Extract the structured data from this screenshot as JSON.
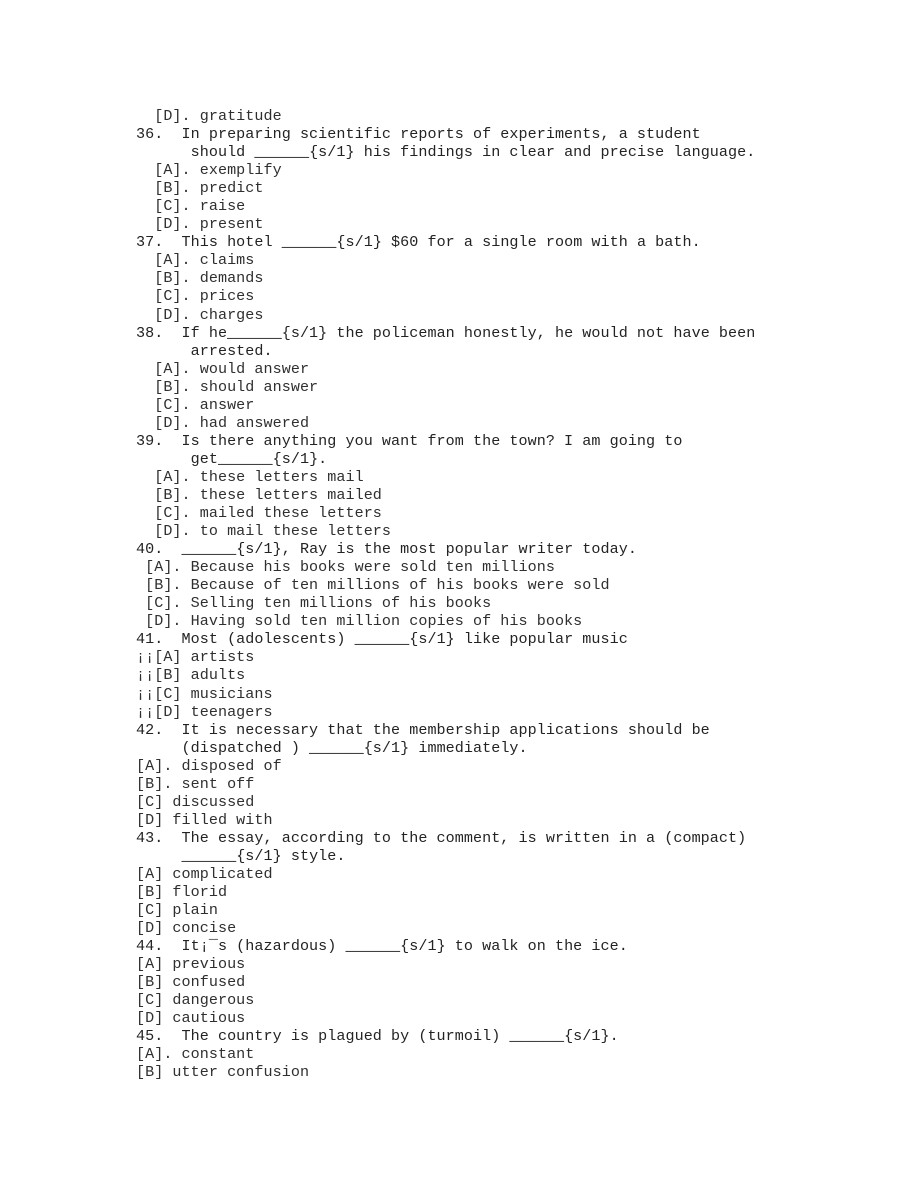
{
  "document": {
    "kind": "scanned-exam-page",
    "subject": "English grammar and vocabulary multiple choice",
    "question_range": "36-45",
    "text_color": "#2b2b2b",
    "page_background": "#ffffff",
    "blank_marker": "______",
    "gap_tag": "{s/1}",
    "mojibake_space": "¡¡",
    "mojibake_apostrophe": "¡‾"
  },
  "lines": [
    {
      "id": "l01",
      "indent": 2,
      "kind": "option",
      "text": "[D]. gratitude"
    },
    {
      "id": "l02",
      "indent": 0,
      "kind": "question",
      "text": "36.  In preparing scientific reports of experiments, a student"
    },
    {
      "id": "l03",
      "indent": 6,
      "kind": "continuation",
      "text": "should ______{s/1} his findings in clear and precise language."
    },
    {
      "id": "l04",
      "indent": 2,
      "kind": "option",
      "text": "[A]. exemplify"
    },
    {
      "id": "l05",
      "indent": 2,
      "kind": "option",
      "text": "[B]. predict"
    },
    {
      "id": "l06",
      "indent": 2,
      "kind": "option",
      "text": "[C]. raise"
    },
    {
      "id": "l07",
      "indent": 2,
      "kind": "option",
      "text": "[D]. present"
    },
    {
      "id": "l08",
      "indent": 0,
      "kind": "question",
      "text": "37.  This hotel ______{s/1} $60 for a single room with a bath."
    },
    {
      "id": "l09",
      "indent": 2,
      "kind": "option",
      "text": "[A]. claims"
    },
    {
      "id": "l10",
      "indent": 2,
      "kind": "option",
      "text": "[B]. demands"
    },
    {
      "id": "l11",
      "indent": 2,
      "kind": "option",
      "text": "[C]. prices"
    },
    {
      "id": "l12",
      "indent": 2,
      "kind": "option",
      "text": "[D]. charges"
    },
    {
      "id": "l13",
      "indent": 0,
      "kind": "question",
      "text": "38.  If he______{s/1} the policeman honestly, he would not have been"
    },
    {
      "id": "l14",
      "indent": 6,
      "kind": "continuation",
      "text": "arrested."
    },
    {
      "id": "l15",
      "indent": 2,
      "kind": "option",
      "text": "[A]. would answer"
    },
    {
      "id": "l16",
      "indent": 2,
      "kind": "option",
      "text": "[B]. should answer"
    },
    {
      "id": "l17",
      "indent": 2,
      "kind": "option",
      "text": "[C]. answer"
    },
    {
      "id": "l18",
      "indent": 2,
      "kind": "option",
      "text": "[D]. had answered"
    },
    {
      "id": "l19",
      "indent": 0,
      "kind": "question",
      "text": "39.  Is there anything you want from the town? I am going to"
    },
    {
      "id": "l20",
      "indent": 6,
      "kind": "continuation",
      "text": "get______{s/1}."
    },
    {
      "id": "l21",
      "indent": 2,
      "kind": "option",
      "text": "[A]. these letters mail"
    },
    {
      "id": "l22",
      "indent": 2,
      "kind": "option",
      "text": "[B]. these letters mailed"
    },
    {
      "id": "l23",
      "indent": 2,
      "kind": "option",
      "text": "[C]. mailed these letters"
    },
    {
      "id": "l24",
      "indent": 2,
      "kind": "option",
      "text": "[D]. to mail these letters"
    },
    {
      "id": "l25",
      "indent": 0,
      "kind": "question",
      "text": "40.  ______{s/1}, Ray is the most popular writer today."
    },
    {
      "id": "l26",
      "indent": 1,
      "kind": "option",
      "text": "[A]. Because his books were sold ten millions"
    },
    {
      "id": "l27",
      "indent": 1,
      "kind": "option",
      "text": "[B]. Because of ten millions of his books were sold"
    },
    {
      "id": "l28",
      "indent": 1,
      "kind": "option",
      "text": "[C]. Selling ten millions of his books"
    },
    {
      "id": "l29",
      "indent": 1,
      "kind": "option",
      "text": "[D]. Having sold ten million copies of his books"
    },
    {
      "id": "l30",
      "indent": 0,
      "kind": "question",
      "text": "41.  Most (adolescents) ______{s/1} like popular music"
    },
    {
      "id": "l31",
      "indent": 0,
      "kind": "option",
      "text": "¡¡[A] artists"
    },
    {
      "id": "l32",
      "indent": 0,
      "kind": "option",
      "text": "¡¡[B] adults"
    },
    {
      "id": "l33",
      "indent": 0,
      "kind": "option",
      "text": "¡¡[C] musicians"
    },
    {
      "id": "l34",
      "indent": 0,
      "kind": "option",
      "text": "¡¡[D] teenagers"
    },
    {
      "id": "l35",
      "indent": 0,
      "kind": "question",
      "text": "42.  It is necessary that the membership applications should be"
    },
    {
      "id": "l36",
      "indent": 5,
      "kind": "continuation",
      "text": "(dispatched ) ______{s/1} immediately."
    },
    {
      "id": "l37",
      "indent": 0,
      "kind": "option",
      "text": "[A]. disposed of"
    },
    {
      "id": "l38",
      "indent": 0,
      "kind": "option",
      "text": "[B]. sent off"
    },
    {
      "id": "l39",
      "indent": 0,
      "kind": "option",
      "text": "[C] discussed"
    },
    {
      "id": "l40",
      "indent": 0,
      "kind": "option",
      "text": "[D] filled with"
    },
    {
      "id": "l41",
      "indent": 0,
      "kind": "question",
      "text": "43.  The essay, according to the comment, is written in a (compact)"
    },
    {
      "id": "l42",
      "indent": 5,
      "kind": "continuation",
      "text": "______{s/1} style."
    },
    {
      "id": "l43",
      "indent": 0,
      "kind": "option",
      "text": "[A] complicated"
    },
    {
      "id": "l44",
      "indent": 0,
      "kind": "option",
      "text": "[B] florid"
    },
    {
      "id": "l45",
      "indent": 0,
      "kind": "option",
      "text": "[C] plain"
    },
    {
      "id": "l46",
      "indent": 0,
      "kind": "option",
      "text": "[D] concise"
    },
    {
      "id": "l47",
      "indent": 0,
      "kind": "question",
      "text": "44.  It¡‾s (hazardous) ______{s/1} to walk on the ice."
    },
    {
      "id": "l48",
      "indent": 0,
      "kind": "option",
      "text": "[A] previous"
    },
    {
      "id": "l49",
      "indent": 0,
      "kind": "option",
      "text": "[B] confused"
    },
    {
      "id": "l50",
      "indent": 0,
      "kind": "option",
      "text": "[C] dangerous"
    },
    {
      "id": "l51",
      "indent": 0,
      "kind": "option",
      "text": "[D] cautious"
    },
    {
      "id": "l52",
      "indent": 0,
      "kind": "question",
      "text": "45.  The country is plagued by (turmoil) ______{s/1}."
    },
    {
      "id": "l53",
      "indent": 0,
      "kind": "option",
      "text": "[A]. constant"
    },
    {
      "id": "l54",
      "indent": 0,
      "kind": "option",
      "text": "[B] utter confusion"
    }
  ]
}
